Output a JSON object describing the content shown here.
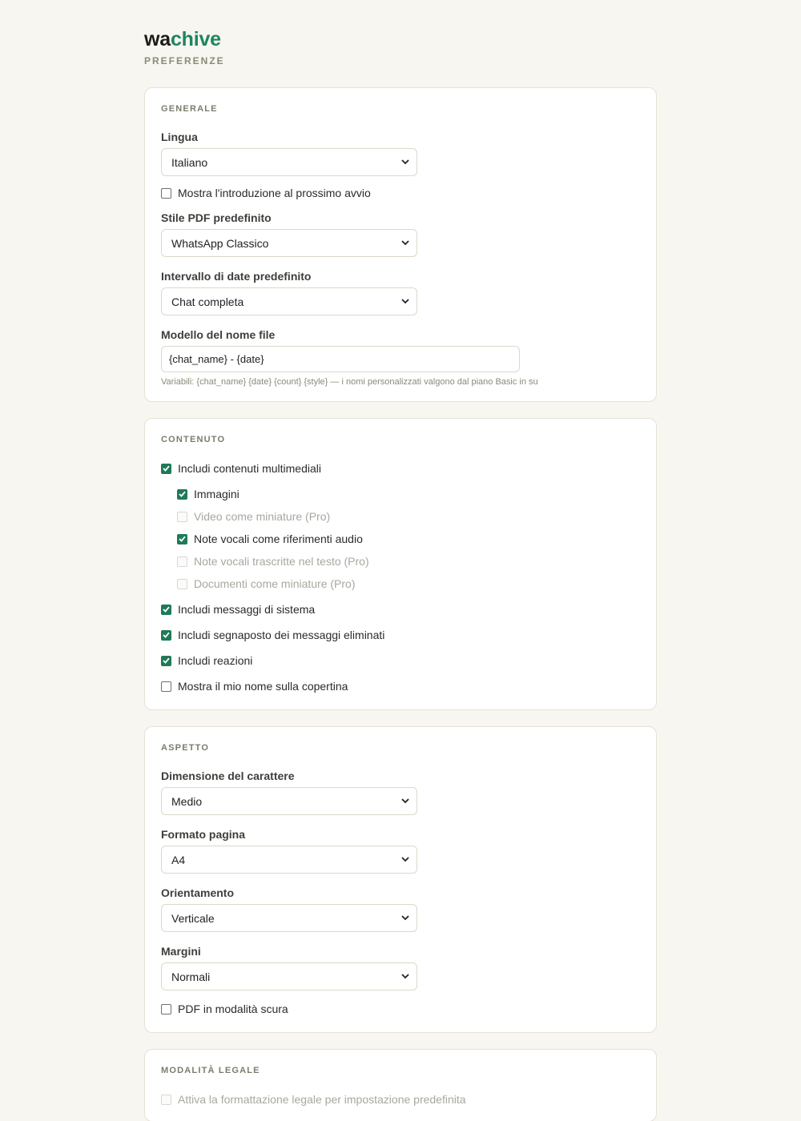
{
  "brand": {
    "logo_part1": "wa",
    "logo_part2": "chive",
    "subtitle": "PREFERENZE"
  },
  "colors": {
    "accent": "#1d8560",
    "checkbox": "#1f7a58",
    "background": "#f8f6f0"
  },
  "generale": {
    "title": "GENERALE",
    "lingua_label": "Lingua",
    "lingua_value": "Italiano",
    "intro_check": "Mostra l'introduzione al prossimo avvio",
    "stile_label": "Stile PDF predefinito",
    "stile_value": "WhatsApp Classico",
    "intervallo_label": "Intervallo di date predefinito",
    "intervallo_value": "Chat completa",
    "modello_label": "Modello del nome file",
    "modello_value": "{chat_name} - {date}",
    "modello_hint": "Variabili: {chat_name} {date} {count} {style} — i nomi personalizzati valgono dal piano Basic in su"
  },
  "contenuto": {
    "title": "CONTENUTO",
    "media": "Includi contenuti multimediali",
    "immagini": "Immagini",
    "video": "Video come miniature (Pro)",
    "note_audio": "Note vocali come riferimenti audio",
    "note_testo": "Note vocali trascritte nel testo (Pro)",
    "documenti": "Documenti come miniature (Pro)",
    "sistema": "Includi messaggi di sistema",
    "eliminati": "Includi segnaposto dei messaggi eliminati",
    "reazioni": "Includi reazioni",
    "nome_copertina": "Mostra il mio nome sulla copertina"
  },
  "aspetto": {
    "title": "ASPETTO",
    "carattere_label": "Dimensione del carattere",
    "carattere_value": "Medio",
    "formato_label": "Formato pagina",
    "formato_value": "A4",
    "orientamento_label": "Orientamento",
    "orientamento_value": "Verticale",
    "margini_label": "Margini",
    "margini_value": "Normali",
    "scura_check": "PDF in modalità scura"
  },
  "legale": {
    "title": "MODALITÀ LEGALE",
    "attiva_check": "Attiva la formattazione legale per impostazione predefinita"
  }
}
